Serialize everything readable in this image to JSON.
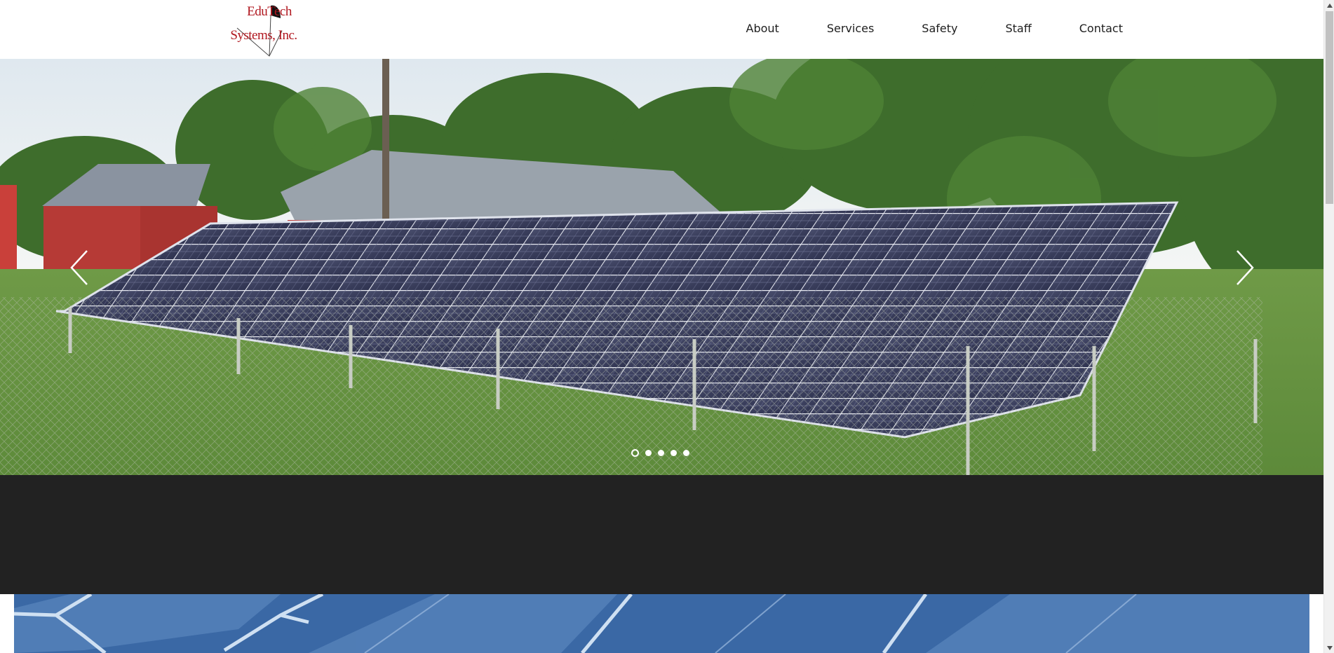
{
  "brand": {
    "logo_line1": "EduTech",
    "logo_line2": "Systems, Inc.",
    "logo_color": "#b0161e"
  },
  "nav": {
    "items": [
      {
        "label": "About"
      },
      {
        "label": "Services"
      },
      {
        "label": "Safety"
      },
      {
        "label": "Staff"
      },
      {
        "label": "Contact"
      }
    ]
  },
  "hero": {
    "image": "solar-panel-array-field",
    "prev_icon": "chevron-left-icon",
    "next_icon": "chevron-right-icon",
    "slide_count": 5,
    "active_slide": 1
  },
  "colors": {
    "band": "#222222",
    "nav_text": "#1e1e1e",
    "strip_blue": "#3d6aa6"
  },
  "strip": {
    "image": "solar-cell-closeup"
  }
}
